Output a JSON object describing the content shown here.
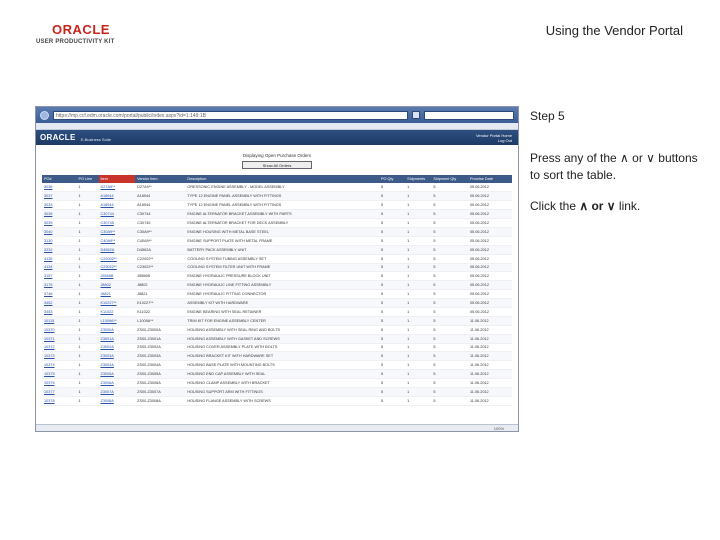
{
  "header": {
    "logo_text": "ORACLE",
    "logo_subtitle": "USER PRODUCTIVITY KIT",
    "title": "Using the Vendor Portal"
  },
  "browser": {
    "url": "https://mp.ccf.edm.oracle.com/portal/public/index.aspx?id=1:149:1B"
  },
  "app": {
    "logo": "ORACLE",
    "name": "E-Business Suite",
    "vendor_link": "Vendor Portal Home",
    "logout_link": "Log Out",
    "table_title": "Displaying Open Purchase Orders",
    "show_button": "Show All Orders",
    "status_zoom": "100%"
  },
  "table": {
    "columns": [
      "PO#",
      "PO Line",
      "Item",
      "Vendor Item",
      "Description",
      "PO Qty",
      "Shipments",
      "Shipment Qty",
      "Promise Date"
    ],
    "rows": [
      [
        "3036",
        "1",
        "D27A9**",
        "D27A9**",
        "ORESSONIC ENGINE ASSEMBLY - MODEL ASSEMBLY",
        "5",
        "1",
        "5",
        "05.06.2012"
      ],
      [
        "3037",
        "1",
        "A18944",
        "A18944",
        "TYPE 12 ENGINE PANEL ASSEMBLY WITH FITTINGS",
        "5",
        "1",
        "5",
        "05.06.2012"
      ],
      [
        "3033",
        "1",
        "A18944",
        "A18944",
        "TYPE 12 ENGINE PANEL ASSEMBLY WITH FITTINGS",
        "5",
        "1",
        "5",
        "05.06.2012"
      ],
      [
        "3035",
        "1",
        "C30744",
        "C30744",
        "ENGINE ALTERNATOR BRACKET ASSEMBLY WITH PARTS",
        "5",
        "1",
        "5",
        "05.06.2012"
      ],
      [
        "3039",
        "1",
        "C30745",
        "C30745",
        "ENGINE ALTERNATOR BRACKET FOR DECK ASSEMBLY",
        "5",
        "1",
        "5",
        "05.06.2012"
      ],
      [
        "3040",
        "1",
        "C30A9**",
        "C30A9**",
        "ENGINE HOUSING WITH METAL BASE STEEL",
        "5",
        "1",
        "5",
        "05.06.2012"
      ],
      [
        "3130",
        "1",
        "C40A9**",
        "C40A9**",
        "ENGINE SUPPORT PLATE WITH METAL FRAME",
        "5",
        "1",
        "5",
        "05.06.2012"
      ],
      [
        "3232",
        "1",
        "D4562A",
        "D4562A",
        "BATTERY PACK ASSEMBLY UNIT",
        "5",
        "1",
        "5",
        "05.06.2012"
      ],
      [
        "4135",
        "1",
        "C22002**",
        "C22002**",
        "COOLING SYSTEM TUBING ASSEMBLY SET",
        "5",
        "1",
        "5",
        "05.06.2012"
      ],
      [
        "4134",
        "1",
        "C23022**",
        "C23022**",
        "COOLING SYSTEM FILTER UNIT WITH FRAME",
        "5",
        "1",
        "5",
        "05.06.2012"
      ],
      [
        "3157",
        "1",
        "J5566B",
        "J5566B",
        "ENGINE HYDRAULIC PRESSURE BLOCK UNIT",
        "5",
        "1",
        "5",
        "05.06.2012"
      ],
      [
        "3175",
        "1",
        "J8802",
        "J8802",
        "ENGINE HYDRAULIC LINE FITTING ASSEMBLY",
        "5",
        "1",
        "5",
        "05.06.2012"
      ],
      [
        "3746",
        "1",
        "J8821",
        "J8821",
        "ENGINE HYDRAULIC FITTING CONNECTOR",
        "5",
        "1",
        "5",
        "05.06.2012"
      ],
      [
        "3452",
        "1",
        "K10227**",
        "K10227**",
        "ASSEMBLY KIT WITH HARDWARE",
        "5",
        "1",
        "5",
        "05.06.2012"
      ],
      [
        "3453",
        "1",
        "K11022",
        "K11022",
        "ENGINE BEARING WITH SEAL RETAINER",
        "5",
        "1",
        "5",
        "05.06.2012"
      ],
      [
        "10115",
        "1",
        "L1009A**",
        "L1009A**",
        "TRIM KIT FOR ENGINE ASSEMBLY CENTER",
        "5",
        "1",
        "5",
        "11.06.2012"
      ],
      [
        "10370",
        "1",
        "Z3000A",
        "ZS00-Z3000A",
        "HOUSING ASSEMBLY WITH SEAL RING AND BOLTS",
        "5",
        "1",
        "5",
        "11.06.2012"
      ],
      [
        "10371",
        "1",
        "Z3001A",
        "ZS00-Z3001A",
        "HOUSING ASSEMBLY WITH GASKET AND SCREWS",
        "5",
        "1",
        "5",
        "11.06.2012"
      ],
      [
        "10372",
        "1",
        "Z3002A",
        "ZS00-Z3002A",
        "HOUSING COVER ASSEMBLY PLATE WITH BOLTS",
        "5",
        "1",
        "5",
        "11.06.2012"
      ],
      [
        "10373",
        "1",
        "Z3003A",
        "ZS00-Z3003A",
        "HOUSING BRACKET KIT WITH HARDWARE SET",
        "5",
        "1",
        "5",
        "11.06.2012"
      ],
      [
        "10374",
        "1",
        "Z3004A",
        "ZS00-Z3004A",
        "HOUSING BASE PLATE WITH MOUNTING BOLTS",
        "5",
        "1",
        "5",
        "11.06.2012"
      ],
      [
        "10375",
        "1",
        "Z3005A",
        "ZS00-Z3005A",
        "HOUSING END CAP ASSEMBLY WITH SEAL",
        "5",
        "1",
        "5",
        "11.06.2012"
      ],
      [
        "10376",
        "1",
        "Z3006A",
        "ZS00-Z3006A",
        "HOUSING CLAMP ASSEMBLY WITH BRACKET",
        "5",
        "1",
        "5",
        "11.06.2012"
      ],
      [
        "10377",
        "1",
        "Z3007A",
        "ZS00-Z3007A",
        "HOUSING SUPPORT ARM WITH FITTINGS",
        "5",
        "1",
        "5",
        "11.06.2012"
      ],
      [
        "10378",
        "1",
        "Z3008A",
        "ZS00-Z3008A",
        "HOUSING FLANGE ASSEMBLY WITH SCREWS",
        "5",
        "1",
        "5",
        "11.06.2012"
      ]
    ]
  },
  "instructions": {
    "step": "Step 5",
    "body": "Press any of the ∧ or ∨ buttons to sort the table.",
    "click_prefix": "Click the ",
    "click_target": "∧ or ∨",
    "click_suffix": " link."
  },
  "colors": {
    "oracle_red": "#c9241b",
    "table_header": "#3d5b88",
    "sorted_header": "#c8332a",
    "link": "#2a52a8"
  }
}
